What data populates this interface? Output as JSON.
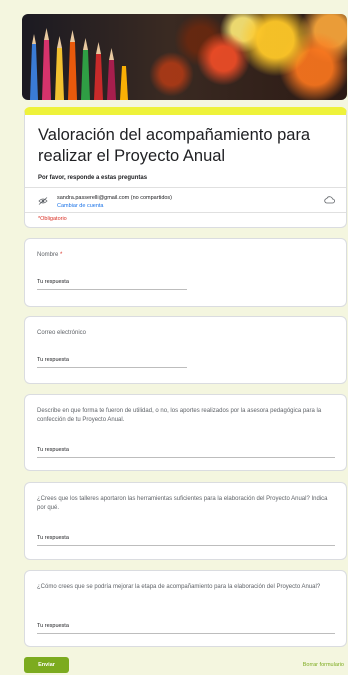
{
  "form": {
    "title": "Valoración del acompañamiento para realizar el Proyecto Anual",
    "description": "Por favor, responde a estas preguntas",
    "account_email": "sandra.passerelli@gmail.com (no compartidos)",
    "switch_account": "Cambiar de cuenta",
    "required_note": "*Obligatorio"
  },
  "questions": [
    {
      "label": "Nombre",
      "required": "*",
      "answer_placeholder": "Tu respuesta"
    },
    {
      "label": "Correo electrónico",
      "answer_placeholder": "Tu respuesta"
    },
    {
      "label": "Describe en que forma te fueron de utilidad, o no, los aportes realizados por la asesora pedagógica para la confección de tu Proyecto Anual.",
      "answer_placeholder": "Tu respuesta"
    },
    {
      "label": "¿Crees que los talleres aportaron las herramientas suficientes para la elaboración del Proyecto Anual? Indica por qué.",
      "answer_placeholder": "Tu respuesta"
    },
    {
      "label": "¿Cómo crees que se podría mejorar la etapa de acompañamiento para la elaboración del Proyecto Anual?",
      "answer_placeholder": "Tu respuesta"
    }
  ],
  "actions": {
    "submit": "Enviar",
    "clear": "Borrar formulario"
  },
  "colors": {
    "accent": "#7cab1f",
    "banner_strip": "#eef23a",
    "required": "#d93025",
    "link": "#1a73e8"
  }
}
